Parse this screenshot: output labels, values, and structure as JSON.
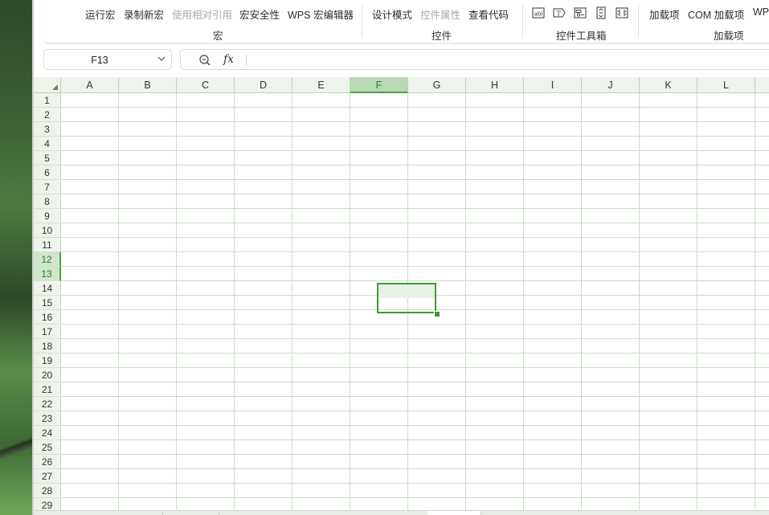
{
  "ribbon": {
    "groups": [
      {
        "label": "宏",
        "items": [
          {
            "label": "运行宏",
            "disabled": false
          },
          {
            "label": "录制新宏",
            "disabled": false
          },
          {
            "label": "使用相对引用",
            "disabled": true
          },
          {
            "label": "宏安全性",
            "disabled": false
          },
          {
            "label": "WPS 宏编辑器",
            "disabled": false
          }
        ]
      },
      {
        "label": "控件",
        "items": [
          {
            "label": "设计模式",
            "disabled": false
          },
          {
            "label": "控件属性",
            "disabled": true
          },
          {
            "label": "查看代码",
            "disabled": false
          }
        ]
      },
      {
        "label": "控件工具箱",
        "icons": [
          "textbox-icon",
          "label-icon",
          "combobox-icon",
          "spin-button-icon",
          "scrollbar-icon"
        ]
      },
      {
        "label": "加载项",
        "items": [
          {
            "label": "加载项",
            "disabled": false
          },
          {
            "label": "COM 加载项",
            "disabled": false
          },
          {
            "label": "WP",
            "disabled": false
          }
        ]
      }
    ]
  },
  "formula_bar": {
    "name_box": "F13",
    "fx_label": "fx",
    "formula": ""
  },
  "sheet": {
    "columns": [
      "A",
      "B",
      "C",
      "D",
      "E",
      "F",
      "G",
      "H",
      "I",
      "J",
      "K",
      "L"
    ],
    "rows": [
      "1",
      "2",
      "3",
      "4",
      "5",
      "6",
      "7",
      "8",
      "9",
      "10",
      "11",
      "12",
      "13",
      "14",
      "15",
      "16",
      "17",
      "18",
      "19",
      "20",
      "21",
      "22",
      "23",
      "24",
      "25",
      "26",
      "27",
      "28",
      "29"
    ],
    "selected_column": "F",
    "selected_rows": [
      "12",
      "13"
    ],
    "active_cell": "F13"
  },
  "colors": {
    "accent": "#3d9a35",
    "header_bg": "#eef3ec",
    "selected_header_bg": "#b9d9b4",
    "gridline": "#c9dec6"
  }
}
